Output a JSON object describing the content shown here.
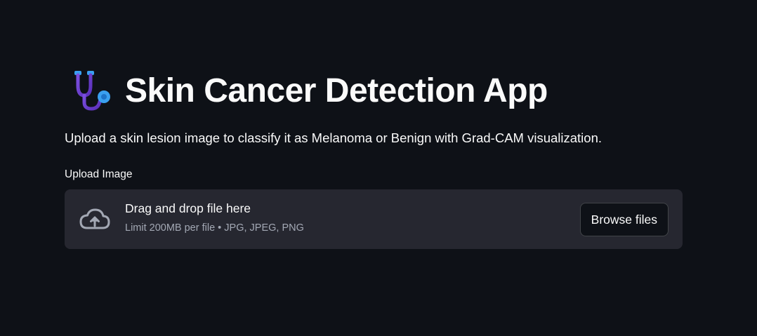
{
  "header": {
    "title": "Skin Cancer Detection App",
    "icon": "stethoscope-icon",
    "description": "Upload a skin lesion image to classify it as Melanoma or Benign with Grad-CAM visualization."
  },
  "uploader": {
    "label": "Upload Image",
    "icon": "cloud-upload-icon",
    "drop_title": "Drag and drop file here",
    "limit_text": "Limit 200MB per file • JPG, JPEG, PNG",
    "browse_label": "Browse files"
  },
  "colors": {
    "background": "#0e1117",
    "dropzone": "#262730",
    "text": "#fafafa",
    "muted_text": "#a3a8b4",
    "icon_blue": "#3aa0f0",
    "icon_purple": "#6a3fc8"
  }
}
